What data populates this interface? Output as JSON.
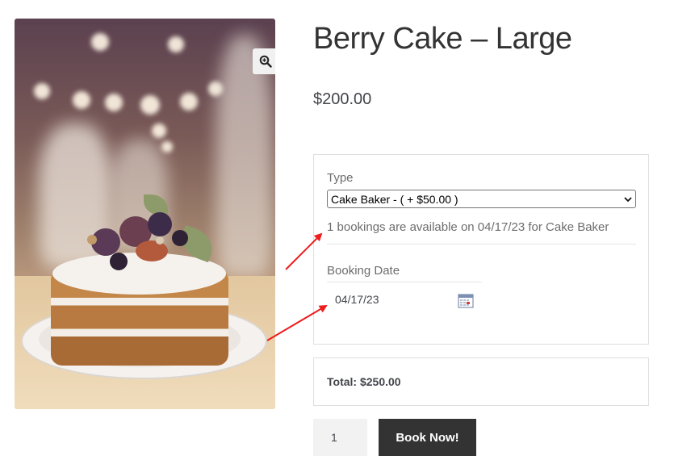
{
  "product": {
    "title": "Berry Cake – Large",
    "price": "$200.00"
  },
  "booking": {
    "type_label": "Type",
    "type_selected": "Cake Baker - ( + $50.00 )",
    "availability": "1 bookings are available on 04/17/23 for Cake Baker",
    "date_label": "Booking Date",
    "date_value": "04/17/23"
  },
  "total": {
    "text": "Total: $250.00"
  },
  "cart": {
    "quantity": "1",
    "book_label": "Book Now!"
  },
  "icons": {
    "zoom": "magnifier-zoom-icon",
    "calendar": "calendar-icon",
    "select_caret": "chevron-down-icon"
  },
  "colors": {
    "annotation_arrow": "#ee1c1c",
    "button_bg": "#333333"
  }
}
